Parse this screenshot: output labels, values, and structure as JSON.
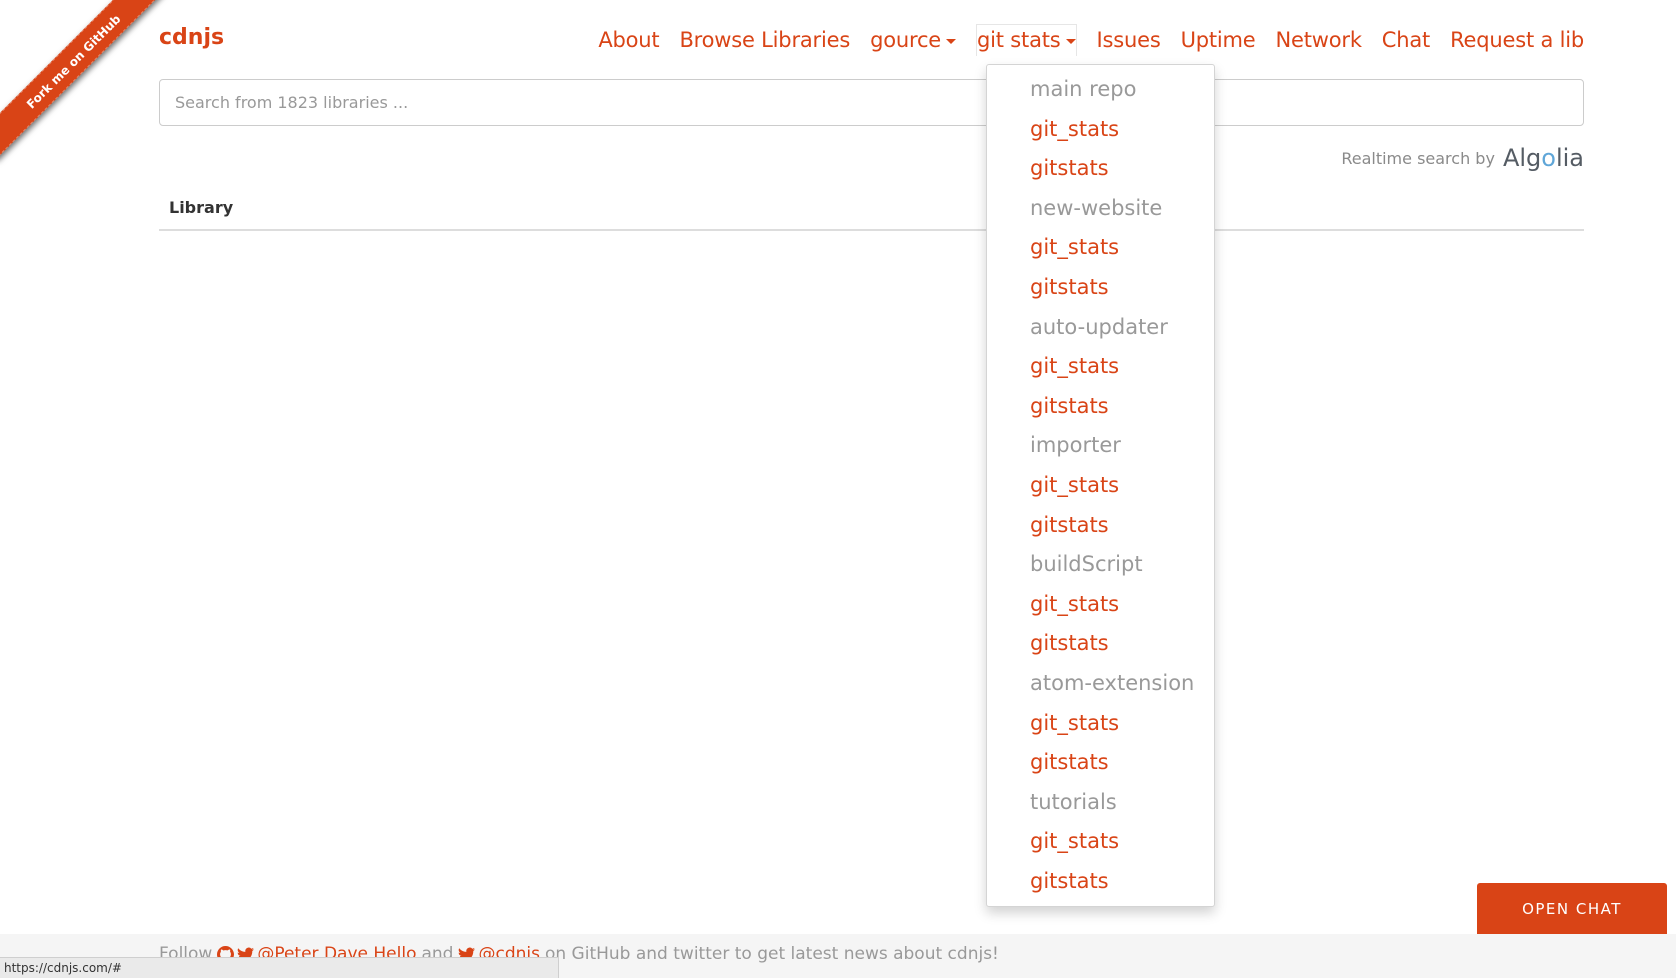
{
  "ribbon": {
    "label": "Fork me on GitHub"
  },
  "brand": "cdnjs",
  "nav": {
    "about": "About",
    "browse": "Browse Libraries",
    "gource": "gource",
    "git_stats": "git stats",
    "issues": "Issues",
    "uptime": "Uptime",
    "network": "Network",
    "chat": "Chat",
    "request": "Request a lib"
  },
  "search": {
    "placeholder": "Search from 1823 libraries ..."
  },
  "algolia": {
    "text": "Realtime search by",
    "logo_pre": "Alg",
    "logo_o": "o",
    "logo_post": "lia"
  },
  "table": {
    "header": "Library"
  },
  "dropdown": {
    "items": [
      {
        "label": "main repo",
        "kind": "header"
      },
      {
        "label": "git_stats",
        "kind": "link"
      },
      {
        "label": "gitstats",
        "kind": "link"
      },
      {
        "label": "new-website",
        "kind": "header"
      },
      {
        "label": "git_stats",
        "kind": "link"
      },
      {
        "label": "gitstats",
        "kind": "link"
      },
      {
        "label": "auto-updater",
        "kind": "header"
      },
      {
        "label": "git_stats",
        "kind": "link"
      },
      {
        "label": "gitstats",
        "kind": "link"
      },
      {
        "label": "importer",
        "kind": "header"
      },
      {
        "label": "git_stats",
        "kind": "link"
      },
      {
        "label": "gitstats",
        "kind": "link"
      },
      {
        "label": "buildScript",
        "kind": "header"
      },
      {
        "label": "git_stats",
        "kind": "link"
      },
      {
        "label": "gitstats",
        "kind": "link"
      },
      {
        "label": "atom-extension",
        "kind": "header"
      },
      {
        "label": "git_stats",
        "kind": "link"
      },
      {
        "label": "gitstats",
        "kind": "link"
      },
      {
        "label": "tutorials",
        "kind": "header"
      },
      {
        "label": "git_stats",
        "kind": "link"
      },
      {
        "label": "gitstats",
        "kind": "link"
      }
    ]
  },
  "chat_button": "OPEN CHAT",
  "footer": {
    "follow": "Follow",
    "user": "@Peter Dave Hello",
    "and": "and",
    "cdnjs": "@cdnjs",
    "tail": "on GitHub and twitter to get latest news about cdnjs!"
  },
  "status_url": "https://cdnjs.com/#",
  "colors": {
    "accent": "#d94416",
    "muted": "#999999"
  },
  "icons": {
    "github": "github-icon",
    "twitter": "twitter-icon",
    "caret": "caret-down-icon"
  }
}
